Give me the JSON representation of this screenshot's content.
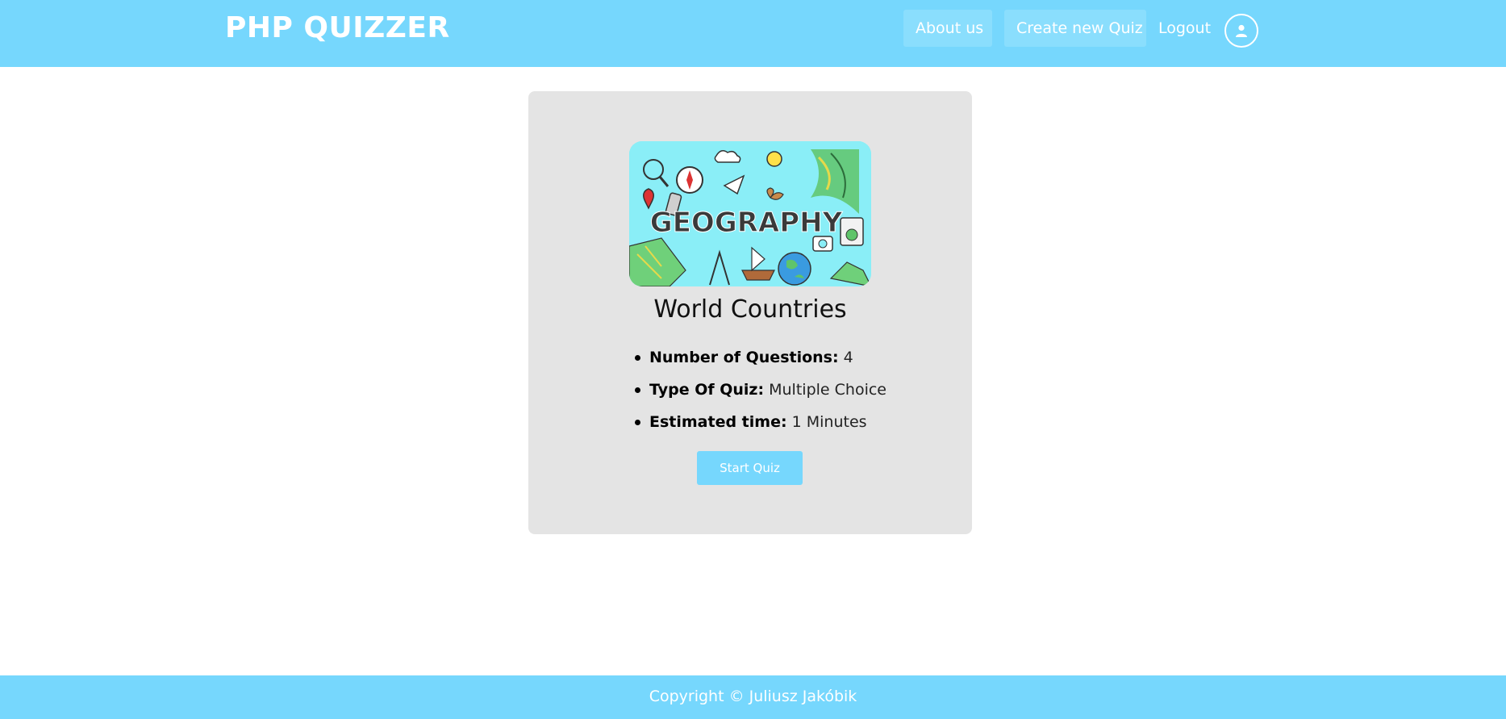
{
  "header": {
    "brand": "PHP QUIZZER",
    "nav": {
      "about_label": "About us",
      "create_label": "Create new Quiz",
      "logout_label": "Logout"
    },
    "avatar_icon": "user-icon"
  },
  "quiz": {
    "image_text": "GEOGRAPHY",
    "title": "World Countries",
    "info": {
      "questions_label": "Number of Questions:",
      "questions_value": "4",
      "type_label": "Type Of Quiz:",
      "type_value": "Multiple Choice",
      "time_label": "Estimated time:",
      "time_value": "1 Minutes"
    },
    "start_label": "Start Quiz"
  },
  "footer": {
    "copyright": "Copyright © Juliusz Jakóbik"
  },
  "colors": {
    "accent": "#76d7fd",
    "card_bg": "#e4e4e4"
  }
}
